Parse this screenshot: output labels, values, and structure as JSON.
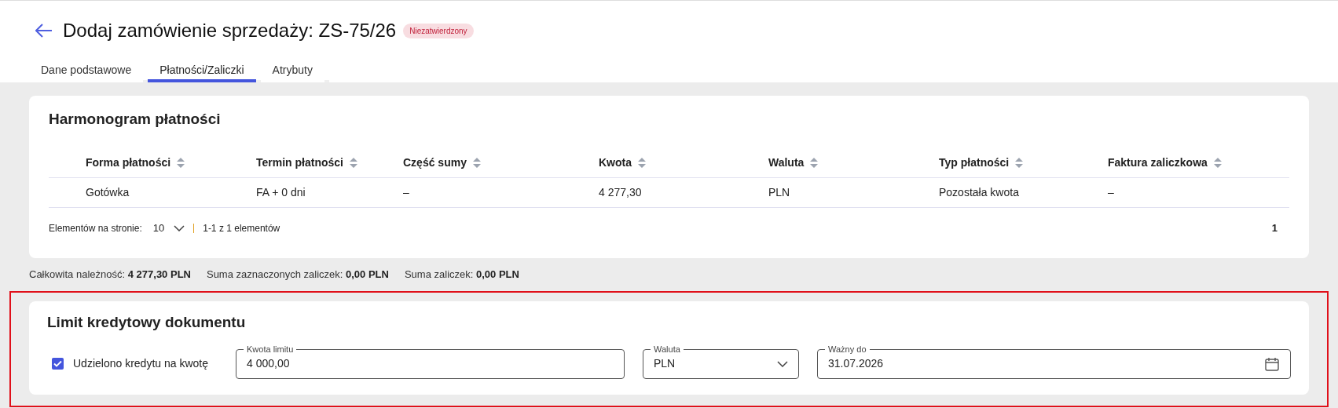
{
  "header": {
    "title": "Dodaj zamówienie sprzedaży: ZS-75/26",
    "status_badge": "Niezatwierdzony"
  },
  "tabs": [
    {
      "label": "Dane podstawowe",
      "selected": false
    },
    {
      "label": "Płatności/Zaliczki",
      "selected": true
    },
    {
      "label": "Atrybuty",
      "selected": false
    }
  ],
  "schedule": {
    "title": "Harmonogram płatności",
    "columns": [
      "Forma płatności",
      "Termin płatności",
      "Część sumy",
      "Kwota",
      "Waluta",
      "Typ płatności",
      "Faktura zaliczkowa"
    ],
    "rows": [
      [
        "Gotówka",
        "FA + 0 dni",
        "–",
        "4 277,30",
        "PLN",
        "Pozostała kwota",
        "–"
      ]
    ],
    "pagination": {
      "per_page_label": "Elementów na stronie:",
      "per_page": "10",
      "range": "1-1 z 1 elementów",
      "page": "1"
    }
  },
  "summary": [
    {
      "label": "Całkowita należność:",
      "value": "4 277,30 PLN"
    },
    {
      "label": "Suma zaznaczonych zaliczek:",
      "value": "0,00 PLN"
    },
    {
      "label": "Suma zaliczek:",
      "value": "0,00 PLN"
    }
  ],
  "credit": {
    "title": "Limit kredytowy dokumentu",
    "checkbox": {
      "label": "Udzielono kredytu na kwotę",
      "checked": true
    },
    "fields": [
      {
        "kind": "text",
        "label": "Kwota limitu",
        "value": "4 000,00"
      },
      {
        "kind": "select",
        "label": "Waluta",
        "value": "PLN"
      },
      {
        "kind": "date",
        "label": "Ważny do",
        "value": "31.07.2026"
      }
    ]
  }
}
